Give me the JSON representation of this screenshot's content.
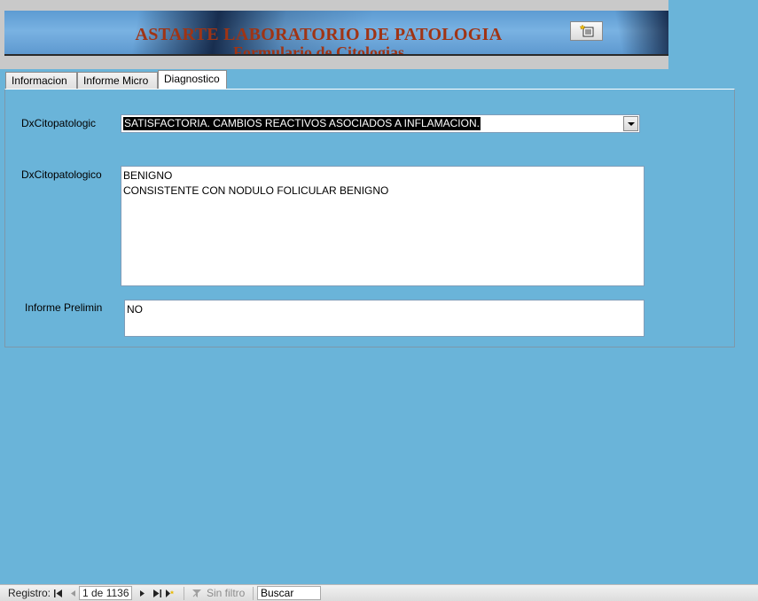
{
  "header": {
    "title": "ASTARTE LABORATORIO DE PATOLOGIA",
    "subtitle": "Formulario de Citologias",
    "button_icon": "new-record-icon"
  },
  "tabs": [
    {
      "label": "Informacion",
      "active": false
    },
    {
      "label": "Informe Micro",
      "active": false
    },
    {
      "label": "Diagnostico",
      "active": true
    }
  ],
  "form": {
    "dx_combo_label": "DxCitopatologic",
    "dx_combo_value": "SATISFACTORIA. CAMBIOS REACTIVOS ASOCIADOS A INFLAMACION.",
    "dx_text_label": "DxCitopatologico",
    "dx_text_value": "BENIGNO\nCONSISTENTE CON NODULO FOLICULAR BENIGNO",
    "prelim_label": "Informe Prelimin",
    "prelim_value": "NO"
  },
  "statusbar": {
    "record_label": "Registro:",
    "record_value": "1 de 1136",
    "filter_label": "Sin filtro",
    "search_placeholder": "Buscar"
  },
  "colors": {
    "background": "#6ab4d9",
    "title": "#a03414"
  }
}
